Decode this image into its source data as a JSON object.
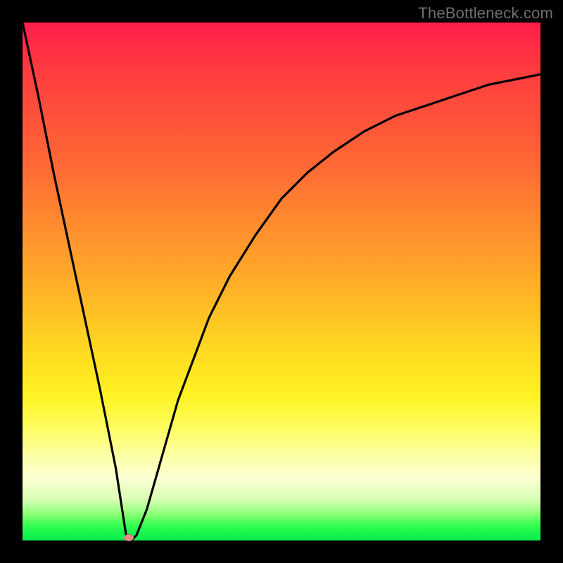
{
  "watermark": "TheBottleneck.com",
  "colors": {
    "frame": "#000000",
    "curve": "#000000",
    "marker": "#e58a88",
    "gradient_top": "#ff1e4a",
    "gradient_bottom": "#0bee4d"
  },
  "chart_data": {
    "type": "line",
    "title": "",
    "xlabel": "",
    "ylabel": "",
    "xlim": [
      0,
      100
    ],
    "ylim": [
      0,
      100
    ],
    "grid": false,
    "legend": false,
    "note": "Axes are unlabeled in the source image; values are estimated as percent of plot width/height (0 = left/bottom, 100 = right/top). A single black curve drops steeply from top-left to a minimum near x≈20, then rises with diminishing slope toward the upper-right. A small pink marker sits at the trough.",
    "series": [
      {
        "name": "curve",
        "x": [
          0,
          3,
          6,
          9,
          12,
          15,
          18,
          20,
          21,
          22,
          24,
          26,
          28,
          30,
          33,
          36,
          40,
          45,
          50,
          55,
          60,
          66,
          72,
          78,
          84,
          90,
          95,
          100
        ],
        "y": [
          100,
          86,
          71,
          57,
          43,
          29,
          14,
          1,
          0,
          1,
          6,
          13,
          20,
          27,
          35,
          43,
          51,
          59,
          66,
          71,
          75,
          79,
          82,
          84,
          86,
          88,
          89,
          90
        ]
      }
    ],
    "marker": {
      "x": 20.5,
      "y": 0.5
    }
  }
}
